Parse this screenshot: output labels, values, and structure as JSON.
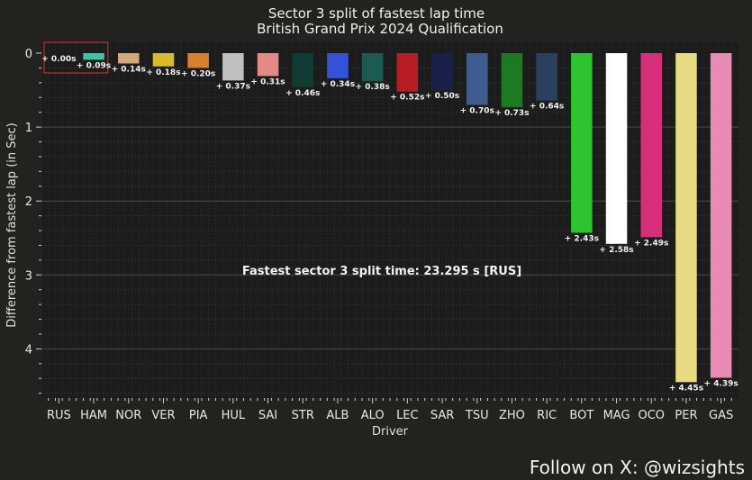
{
  "chart_data": {
    "type": "bar",
    "title": "Sector 3 split of fastest lap time",
    "subtitle": "British Grand Prix 2024 Qualification",
    "xlabel": "Driver",
    "ylabel": "Difference from fastest lap (in Sec)",
    "y_inverted": true,
    "ylim": [
      0,
      4.65
    ],
    "yticks": [
      "0",
      "1",
      "2",
      "3",
      "4"
    ],
    "categories": [
      "RUS",
      "HAM",
      "NOR",
      "VER",
      "PIA",
      "HUL",
      "SAI",
      "STR",
      "ALB",
      "ALO",
      "LEC",
      "SAR",
      "TSU",
      "ZHO",
      "RIC",
      "BOT",
      "MAG",
      "OCO",
      "PER",
      "GAS"
    ],
    "values": [
      0.0,
      0.09,
      0.14,
      0.18,
      0.2,
      0.37,
      0.31,
      0.46,
      0.34,
      0.38,
      0.52,
      0.5,
      0.7,
      0.73,
      0.64,
      2.43,
      2.58,
      2.49,
      4.45,
      4.39
    ],
    "value_labels": [
      "+ 0.00s",
      "+ 0.09s",
      "+ 0.14s",
      "+ 0.18s",
      "+ 0.20s",
      "+ 0.37s",
      "+ 0.31s",
      "+ 0.46s",
      "+ 0.34s",
      "+ 0.38s",
      "+ 0.52s",
      "+ 0.50s",
      "+ 0.70s",
      "+ 0.73s",
      "+ 0.64s",
      "+ 2.43s",
      "+ 2.58s",
      "+ 2.49s",
      "+ 4.45s",
      "+ 4.39s"
    ],
    "colors": [
      "#27f4d2",
      "#3ac5a5",
      "#d6a877",
      "#d8bb2c",
      "#d9802f",
      "#c0c0c0",
      "#e38a86",
      "#0f3b32",
      "#3352d9",
      "#1a5b52",
      "#b81d26",
      "#19204a",
      "#3f5c8e",
      "#1b7a22",
      "#2b3f5e",
      "#2ec431",
      "#ffffff",
      "#d62e78",
      "#e8dc82",
      "#e88cb5"
    ],
    "highlight_index": 0,
    "highlight_color": "#e03030",
    "annotation": "Fastest sector 3 split time: 23.295 s [RUS]",
    "grid": true,
    "background": "#222220",
    "plot_background": "#1c1c1c"
  },
  "footer": {
    "credit": "Follow on X: @wizsights"
  }
}
